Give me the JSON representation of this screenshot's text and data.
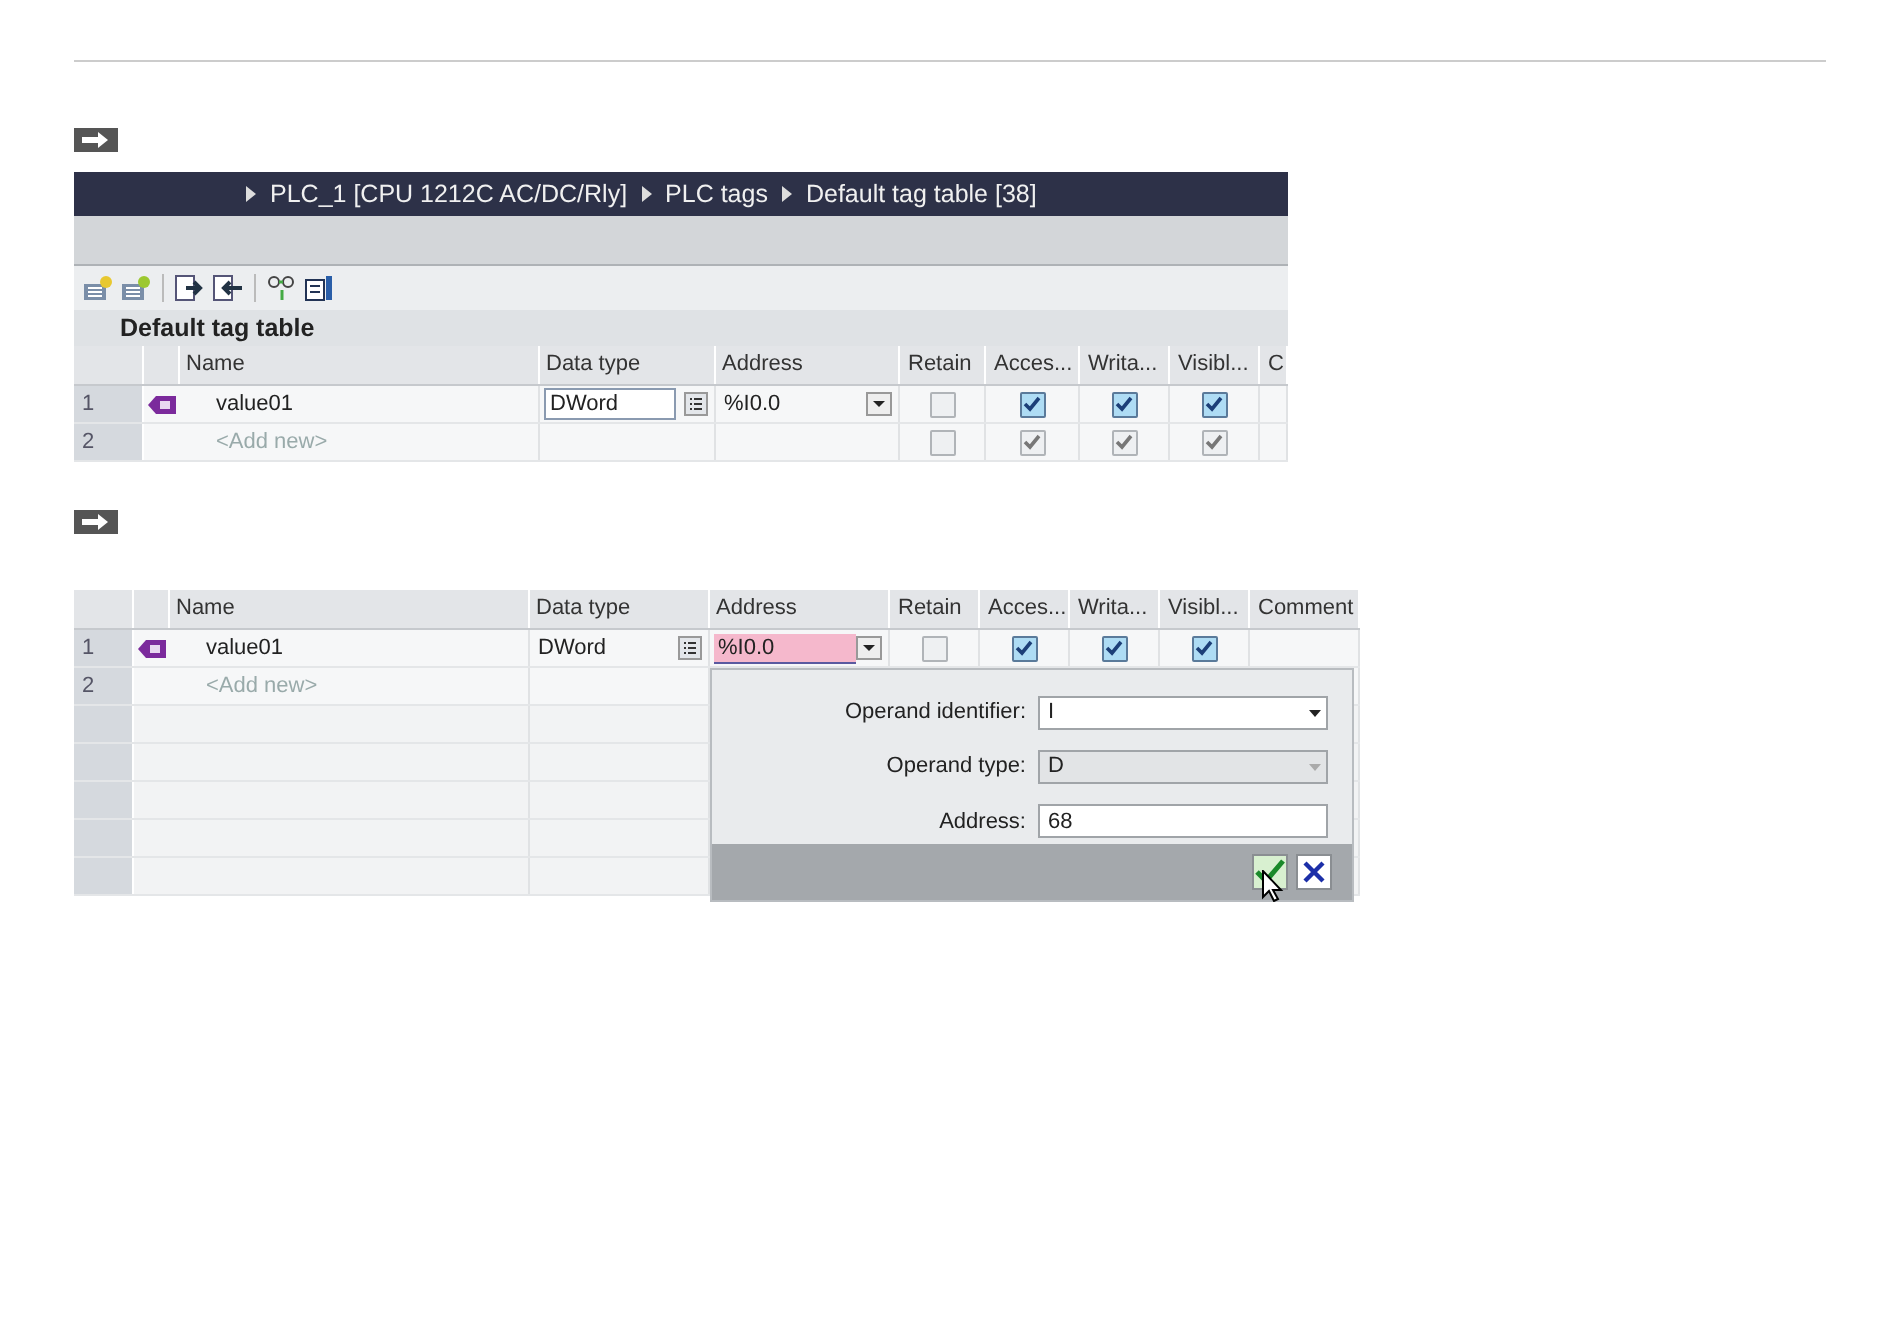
{
  "step1": {
    "breadcrumb": [
      "PLC_1 [CPU 1212C AC/DC/Rly]",
      "PLC tags",
      "Default tag table [38]"
    ],
    "table_title": "Default tag table",
    "columns": [
      "Name",
      "Data type",
      "Address",
      "Retain",
      "Acces...",
      "Writa...",
      "Visibl...",
      "C"
    ],
    "rows": [
      {
        "index": "1",
        "kind": "tag",
        "name": "value01",
        "data_type": "DWord",
        "data_type_editing": true,
        "address": "%I0.0",
        "address_invalid": false,
        "retain": {
          "checked": false,
          "disabled": true
        },
        "accessible": {
          "checked": true,
          "disabled": false
        },
        "writable": {
          "checked": true,
          "disabled": false
        },
        "visible": {
          "checked": true,
          "disabled": false
        }
      },
      {
        "index": "2",
        "kind": "add",
        "name": "<Add new>",
        "retain": {
          "checked": false,
          "disabled": true
        },
        "accessible": {
          "checked": true,
          "disabled": true
        },
        "writable": {
          "checked": true,
          "disabled": true
        },
        "visible": {
          "checked": true,
          "disabled": true
        }
      }
    ]
  },
  "step2": {
    "columns": [
      "Name",
      "Data type",
      "Address",
      "Retain",
      "Acces...",
      "Writa...",
      "Visibl...",
      "Comment"
    ],
    "rows": [
      {
        "index": "1",
        "kind": "tag",
        "name": "value01",
        "data_type": "DWord",
        "data_type_editing": false,
        "address": "%I0.0",
        "address_invalid": true,
        "retain": {
          "checked": false,
          "disabled": true
        },
        "accessible": {
          "checked": true,
          "disabled": false
        },
        "writable": {
          "checked": true,
          "disabled": false
        },
        "visible": {
          "checked": true,
          "disabled": false
        }
      },
      {
        "index": "2",
        "kind": "add",
        "name": "<Add new>"
      }
    ],
    "address_popup": {
      "fields": [
        {
          "label": "Operand identifier:",
          "value": "I",
          "kind": "dropdown",
          "disabled": false
        },
        {
          "label": "Operand type:",
          "value": "D",
          "kind": "dropdown",
          "disabled": true
        },
        {
          "label": "Address:",
          "value": "68",
          "kind": "text",
          "disabled": false
        }
      ]
    }
  }
}
